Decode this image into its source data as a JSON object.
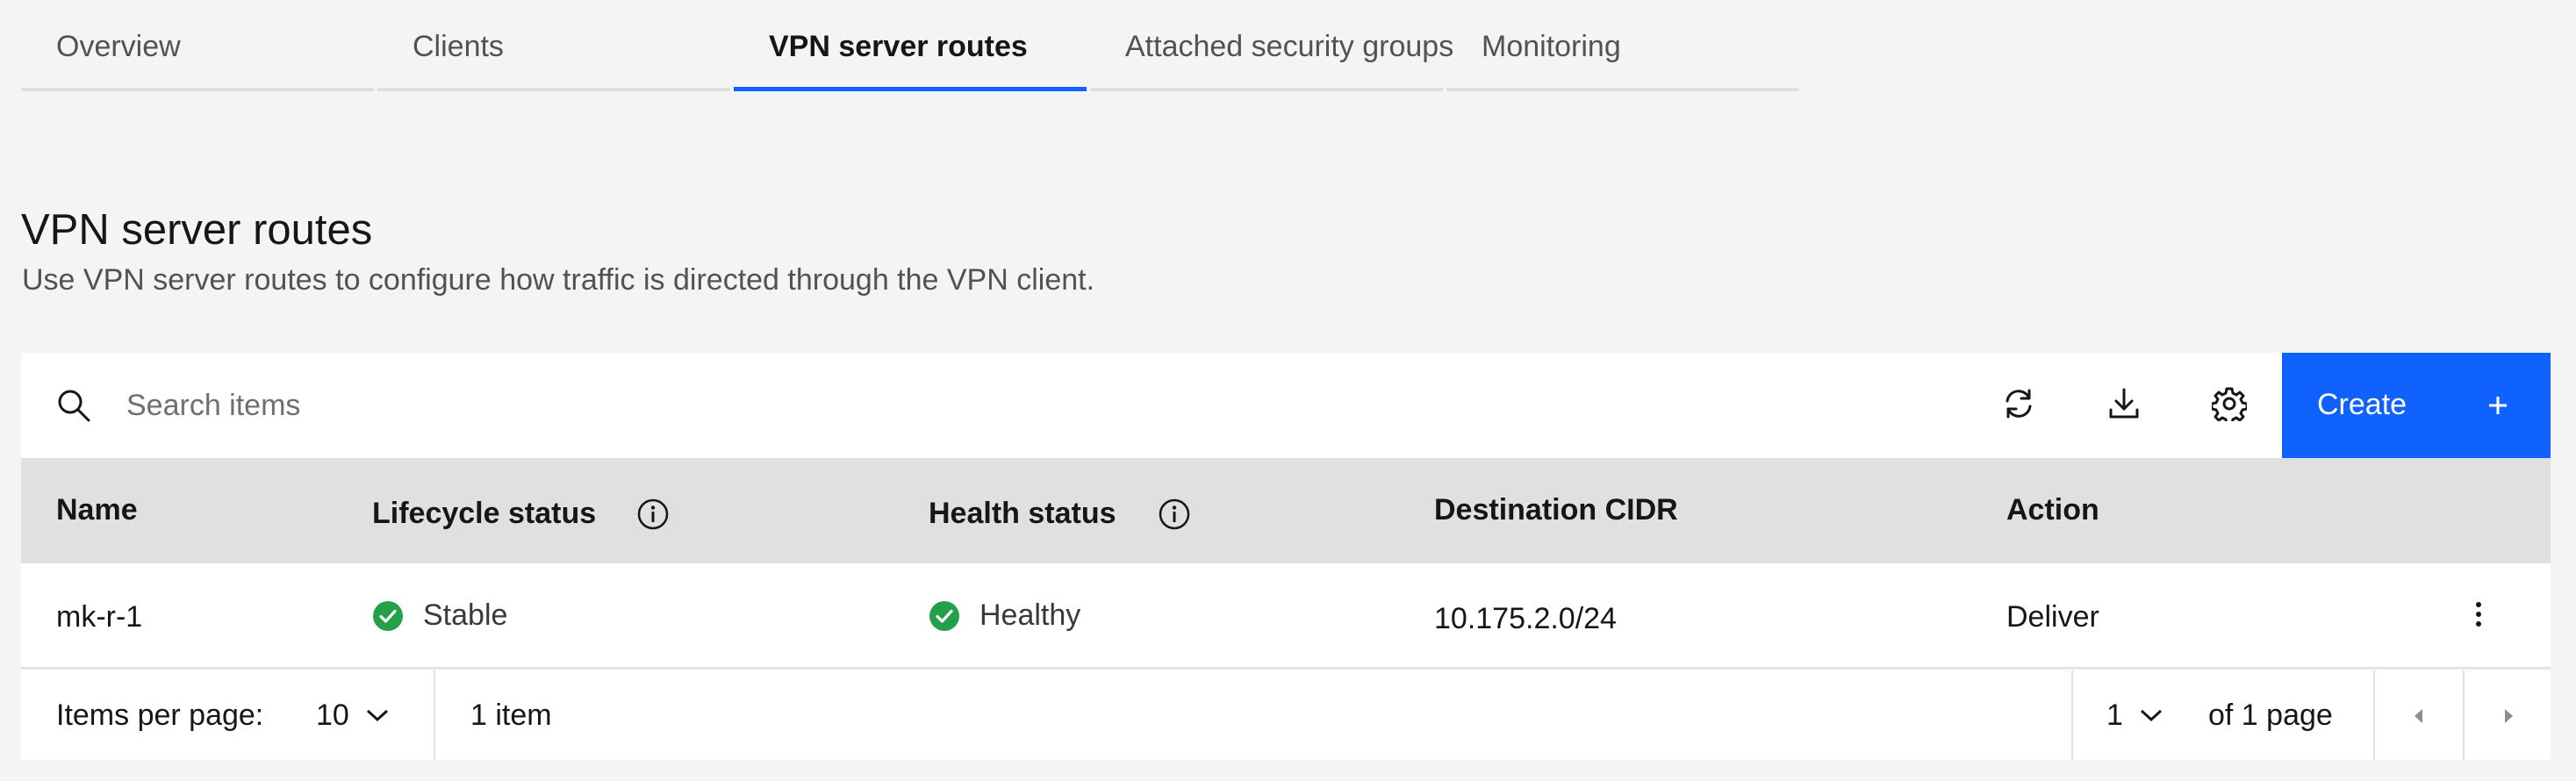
{
  "tabs": [
    {
      "label": "Overview"
    },
    {
      "label": "Clients"
    },
    {
      "label": "VPN server routes",
      "active": true
    },
    {
      "label": "Attached security groups"
    },
    {
      "label": "Monitoring"
    }
  ],
  "header": {
    "title": "VPN server routes",
    "description": "Use VPN server routes to configure how traffic is directed through the VPN client."
  },
  "toolbar": {
    "search_placeholder": "Search items",
    "icons": [
      "refresh-icon",
      "download-icon",
      "settings-icon"
    ],
    "create_label": "Create"
  },
  "table": {
    "columns": [
      "Name",
      "Lifecycle status",
      "Health status",
      "Destination CIDR",
      "Action"
    ],
    "rows": [
      {
        "name": "mk-r-1",
        "lifecycle": "Stable",
        "health": "Healthy",
        "cidr": "10.175.2.0/24",
        "action": "Deliver"
      }
    ]
  },
  "pagination": {
    "items_per_page_label": "Items per page:",
    "items_per_page": "10",
    "item_count": "1 item",
    "page": "1",
    "page_total": "of 1 page"
  },
  "colors": {
    "accent": "#0f62fe",
    "success": "#24a148",
    "header_bg": "#e0e0e0",
    "page_bg": "#f4f4f4"
  }
}
